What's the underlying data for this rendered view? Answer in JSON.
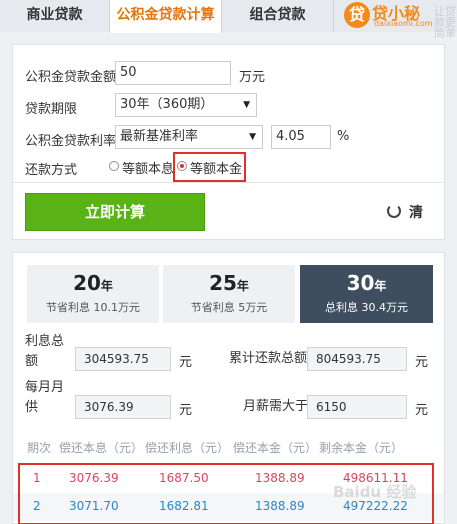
{
  "tabs": [
    {
      "label": "商业贷款",
      "active": false
    },
    {
      "label": "公积金贷款计算",
      "active": true
    },
    {
      "label": "组合贷款",
      "active": false
    }
  ],
  "logo": {
    "mark": "贷",
    "name": "贷小秘",
    "url": "daixiaomi.com",
    "slogan": "让贷款更简单"
  },
  "form": {
    "amount_label": "公积金贷款金额",
    "amount_value": "50",
    "amount_unit": "万元",
    "term_label": "贷款期限",
    "term_value": "30年（360期）",
    "rate_label": "公积金贷款利率",
    "rate_type_value": "最新基准利率",
    "rate_value": "4.05",
    "rate_unit": "%",
    "repay_label": "还款方式",
    "repay_options": [
      {
        "label": "等额本息",
        "selected": false
      },
      {
        "label": "等额本金",
        "selected": true
      }
    ],
    "calc_button": "立即计算",
    "clear_button": "清"
  },
  "year_tabs": [
    {
      "years": "20",
      "unit": "年",
      "caption": "节省利息 10.1万元",
      "active": false
    },
    {
      "years": "25",
      "unit": "年",
      "caption": "节省利息 5万元",
      "active": false
    },
    {
      "years": "30",
      "unit": "年",
      "caption": "总利息 30.4万元",
      "active": true
    }
  ],
  "summary": {
    "total_interest_label": "利息总额",
    "total_interest_value": "304593.75",
    "total_repay_label": "累计还款总额",
    "total_repay_value": "804593.75",
    "monthly_label": "每月月供",
    "monthly_value": "3076.39",
    "salary_label": "月薪需大于",
    "salary_value": "6150",
    "unit": "元"
  },
  "table": {
    "headers": [
      "期次",
      "偿还本息（元）",
      "偿还利息（元）",
      "偿还本金（元）",
      "剩余本金（元）"
    ],
    "rows": [
      [
        "1",
        "3076.39",
        "1687.50",
        "1388.89",
        "498611.11"
      ],
      [
        "2",
        "3071.70",
        "1682.81",
        "1388.89",
        "497222.22"
      ]
    ]
  },
  "watermark": "Baidu 经验",
  "colors": {
    "accent": "#e8740c",
    "button_green": "#5ab316",
    "highlight_red": "#e0302a",
    "row1_text": "#d9455e",
    "row2_text": "#2f86c5"
  }
}
